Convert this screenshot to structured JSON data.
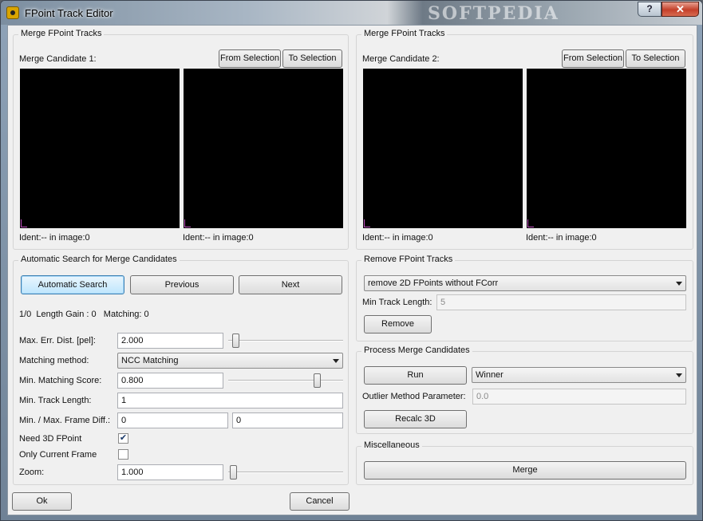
{
  "window": {
    "title": "FPoint Track Editor",
    "watermark": "SOFTPEDIA",
    "help": "?",
    "close": "✕"
  },
  "merge_left": {
    "group_title": "Merge FPoint Tracks",
    "candidate_label": "Merge Candidate 1:",
    "from_selection": "From Selection",
    "to_selection": "To Selection",
    "ident_a": "Ident:-- in image:0",
    "ident_b": "Ident:-- in image:0"
  },
  "merge_right": {
    "group_title": "Merge FPoint Tracks",
    "candidate_label": "Merge Candidate 2:",
    "from_selection": "From Selection",
    "to_selection": "To Selection",
    "ident_a": "Ident:-- in image:0",
    "ident_b": "Ident:-- in image:0"
  },
  "auto_search": {
    "group_title": "Automatic Search for Merge Candidates",
    "automatic_search": "Automatic Search",
    "previous": "Previous",
    "next": "Next",
    "status": "1/0  Length Gain : 0   Matching: 0",
    "max_err_label": "Max. Err. Dist. [pel]:",
    "max_err_value": "2.000",
    "max_err_slider_level": 0.02,
    "matching_method_label": "Matching method:",
    "matching_method_value": "NCC Matching",
    "min_score_label": "Min. Matching Score:",
    "min_score_value": "0.800",
    "min_score_slider_level": 0.8,
    "min_track_label": "Min. Track Length:",
    "min_track_value": "1",
    "frame_diff_label": "Min. / Max. Frame Diff.:",
    "frame_diff_min": "0",
    "frame_diff_max": "0",
    "need3d_label": "Need 3D FPoint",
    "need3d_checked": true,
    "only_current_label": "Only Current Frame",
    "only_current_checked": false,
    "zoom_label": "Zoom:",
    "zoom_value": "1.000",
    "zoom_slider_level": 0.0
  },
  "remove": {
    "group_title": "Remove FPoint Tracks",
    "mode_value": "remove 2D FPoints without FCorr",
    "min_track_label": "Min Track Length:",
    "min_track_value": "5",
    "remove_button": "Remove"
  },
  "process": {
    "group_title": "Process Merge Candidates",
    "run_button": "Run",
    "method_value": "Winner",
    "outlier_label": "Outlier Method Parameter:",
    "outlier_value": "0.0",
    "recalc_button": "Recalc 3D"
  },
  "misc": {
    "group_title": "Miscellaneous",
    "merge_button": "Merge"
  },
  "footer": {
    "ok": "Ok",
    "cancel": "Cancel"
  }
}
